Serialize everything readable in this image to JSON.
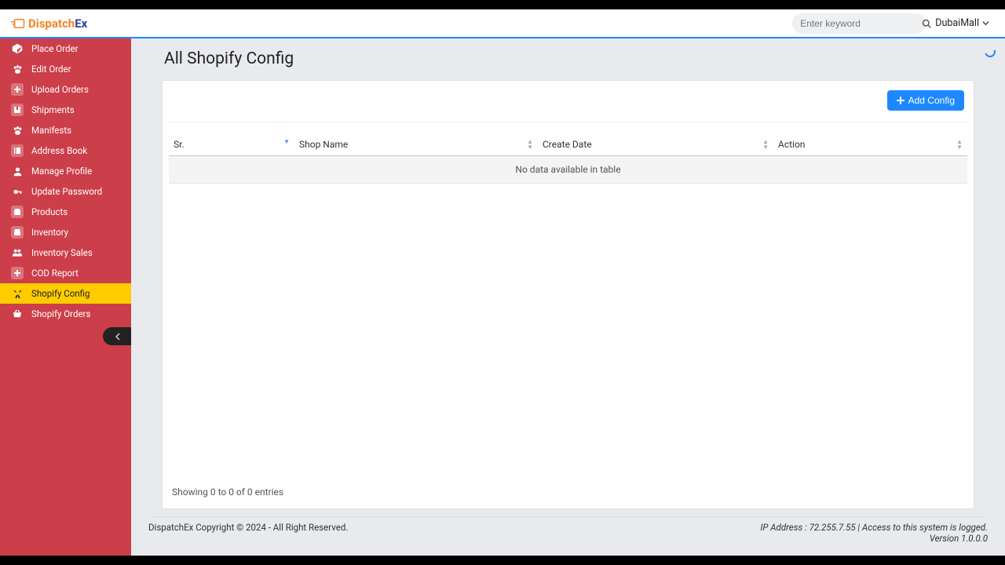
{
  "brand": {
    "name1": "Dispatch",
    "name2": "Ex"
  },
  "search": {
    "placeholder": "Enter keyword"
  },
  "user": {
    "name": "DubaiMall"
  },
  "sidebar": {
    "items": [
      {
        "label": "Place Order",
        "icon": "cube-icon"
      },
      {
        "label": "Edit Order",
        "icon": "paw-icon"
      },
      {
        "label": "Upload Orders",
        "icon": "plus-icon"
      },
      {
        "label": "Shipments",
        "icon": "package-icon"
      },
      {
        "label": "Manifests",
        "icon": "paw-icon"
      },
      {
        "label": "Address Book",
        "icon": "book-icon"
      },
      {
        "label": "Manage Profile",
        "icon": "user-icon"
      },
      {
        "label": "Update Password",
        "icon": "key-icon"
      },
      {
        "label": "Products",
        "icon": "store-icon"
      },
      {
        "label": "Inventory",
        "icon": "store-icon"
      },
      {
        "label": "Inventory Sales",
        "icon": "users-icon"
      },
      {
        "label": "COD Report",
        "icon": "plus-icon"
      },
      {
        "label": "Shopify Config",
        "icon": "tools-icon",
        "active": true
      },
      {
        "label": "Shopify Orders",
        "icon": "basket-icon"
      }
    ]
  },
  "page": {
    "title": "All Shopify Config"
  },
  "toolbar": {
    "add_label": "Add Config"
  },
  "table": {
    "columns": {
      "sr": "Sr.",
      "shop_name": "Shop Name",
      "create_date": "Create Date",
      "action": "Action"
    },
    "empty": "No data available in table",
    "info": "Showing 0 to 0 of 0 entries"
  },
  "footer": {
    "copyright": "DispatchEx Copyright © 2024 - All Right Reserved.",
    "ip_line": "IP Address : 72.255.7.55 | Access to this system is logged.",
    "version": "Version 1.0.0.0"
  }
}
